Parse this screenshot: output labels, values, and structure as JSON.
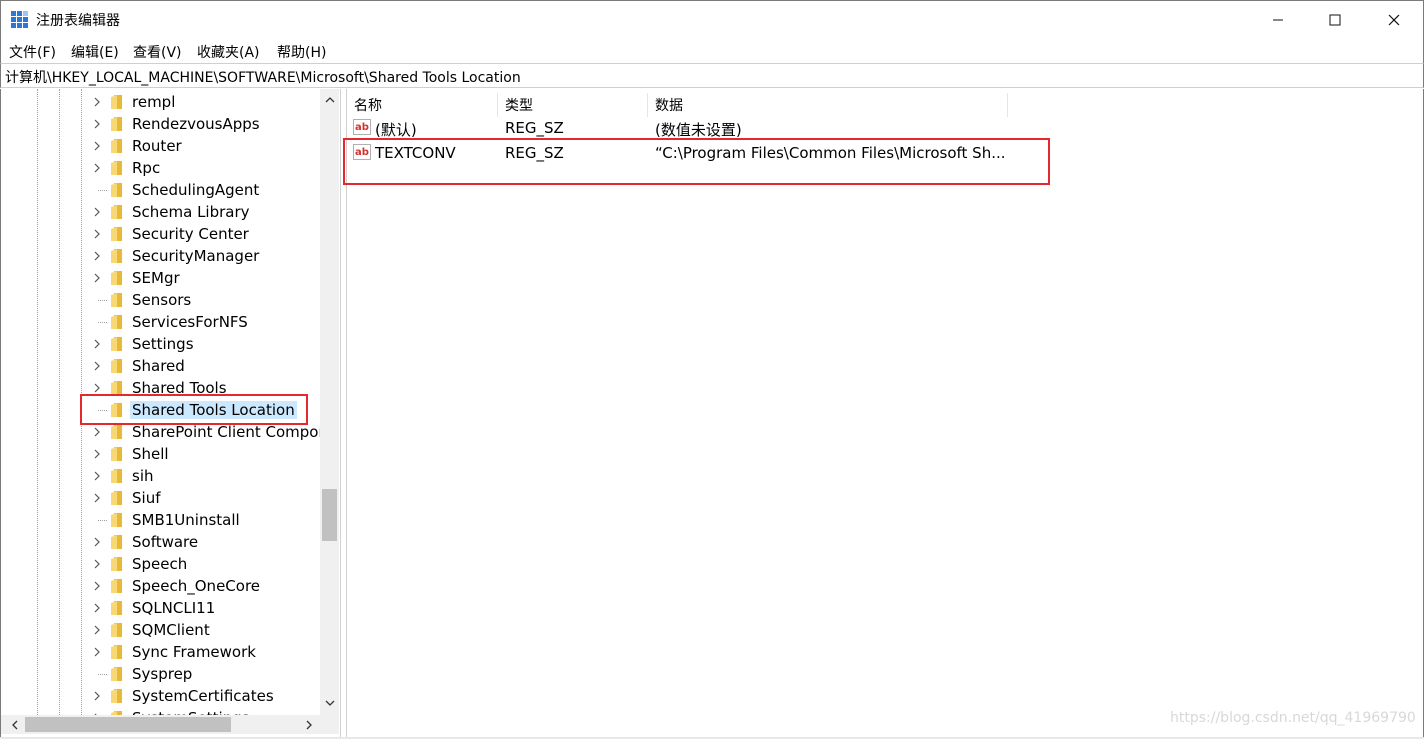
{
  "window": {
    "title": "注册表编辑器",
    "icon": "registry-editor-icon",
    "controls": [
      "minimize-icon",
      "maximize-icon",
      "close-icon"
    ]
  },
  "menu": {
    "items": [
      "文件(F)",
      "编辑(E)",
      "查看(V)",
      "收藏夹(A)",
      "帮助(H)"
    ]
  },
  "address": {
    "path": "计算机\\HKEY_LOCAL_MACHINE\\SOFTWARE\\Microsoft\\Shared Tools Location"
  },
  "tree": {
    "items": [
      {
        "label": "rempl",
        "expandable": true
      },
      {
        "label": "RendezvousApps",
        "expandable": true
      },
      {
        "label": "Router",
        "expandable": true
      },
      {
        "label": "Rpc",
        "expandable": true
      },
      {
        "label": "SchedulingAgent",
        "expandable": false
      },
      {
        "label": "Schema Library",
        "expandable": true
      },
      {
        "label": "Security Center",
        "expandable": true
      },
      {
        "label": "SecurityManager",
        "expandable": true
      },
      {
        "label": "SEMgr",
        "expandable": true
      },
      {
        "label": "Sensors",
        "expandable": false
      },
      {
        "label": "ServicesForNFS",
        "expandable": false
      },
      {
        "label": "Settings",
        "expandable": true
      },
      {
        "label": "Shared",
        "expandable": true
      },
      {
        "label": "Shared Tools",
        "expandable": true
      },
      {
        "label": "Shared Tools Location",
        "expandable": false,
        "selected": true
      },
      {
        "label": "SharePoint Client Compor",
        "expandable": true
      },
      {
        "label": "Shell",
        "expandable": true
      },
      {
        "label": "sih",
        "expandable": true
      },
      {
        "label": "Siuf",
        "expandable": true
      },
      {
        "label": "SMB1Uninstall",
        "expandable": false
      },
      {
        "label": "Software",
        "expandable": true
      },
      {
        "label": "Speech",
        "expandable": true
      },
      {
        "label": "Speech_OneCore",
        "expandable": true
      },
      {
        "label": "SQLNCLI11",
        "expandable": true
      },
      {
        "label": "SQMClient",
        "expandable": true
      },
      {
        "label": "Sync Framework",
        "expandable": true
      },
      {
        "label": "Sysprep",
        "expandable": false
      },
      {
        "label": "SystemCertificates",
        "expandable": true
      },
      {
        "label": "SystemSettings",
        "expandable": true
      }
    ]
  },
  "list": {
    "columns": [
      "名称",
      "类型",
      "数据"
    ],
    "rows": [
      {
        "name": "(默认)",
        "type": "REG_SZ",
        "data": "(数值未设置)",
        "icon": "string-value-icon"
      },
      {
        "name": "TEXTCONV",
        "type": "REG_SZ",
        "data": "“C:\\Program Files\\Common Files\\Microsoft Sh...",
        "icon": "string-value-icon"
      }
    ]
  },
  "annotation": {
    "highlight_color": "#e5282c"
  },
  "watermark": "https://blog.csdn.net/qq_41969790"
}
